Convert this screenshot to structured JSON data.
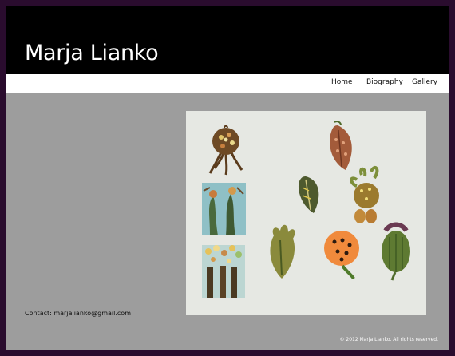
{
  "site": {
    "title": "Marja Lianko"
  },
  "nav": {
    "items": [
      {
        "label": "Home"
      },
      {
        "label": "Biography"
      },
      {
        "label": "Gallery"
      }
    ]
  },
  "contact": {
    "text": "Contact: marjalianko@gmail.com"
  },
  "footer": {
    "copyright": "© 2012 Marja Lianko. All rights reserved."
  },
  "colors": {
    "outer_border": "#2a0c2e",
    "header_bg": "#000000",
    "nav_bg": "#ffffff",
    "content_bg": "#9d9d9d"
  }
}
